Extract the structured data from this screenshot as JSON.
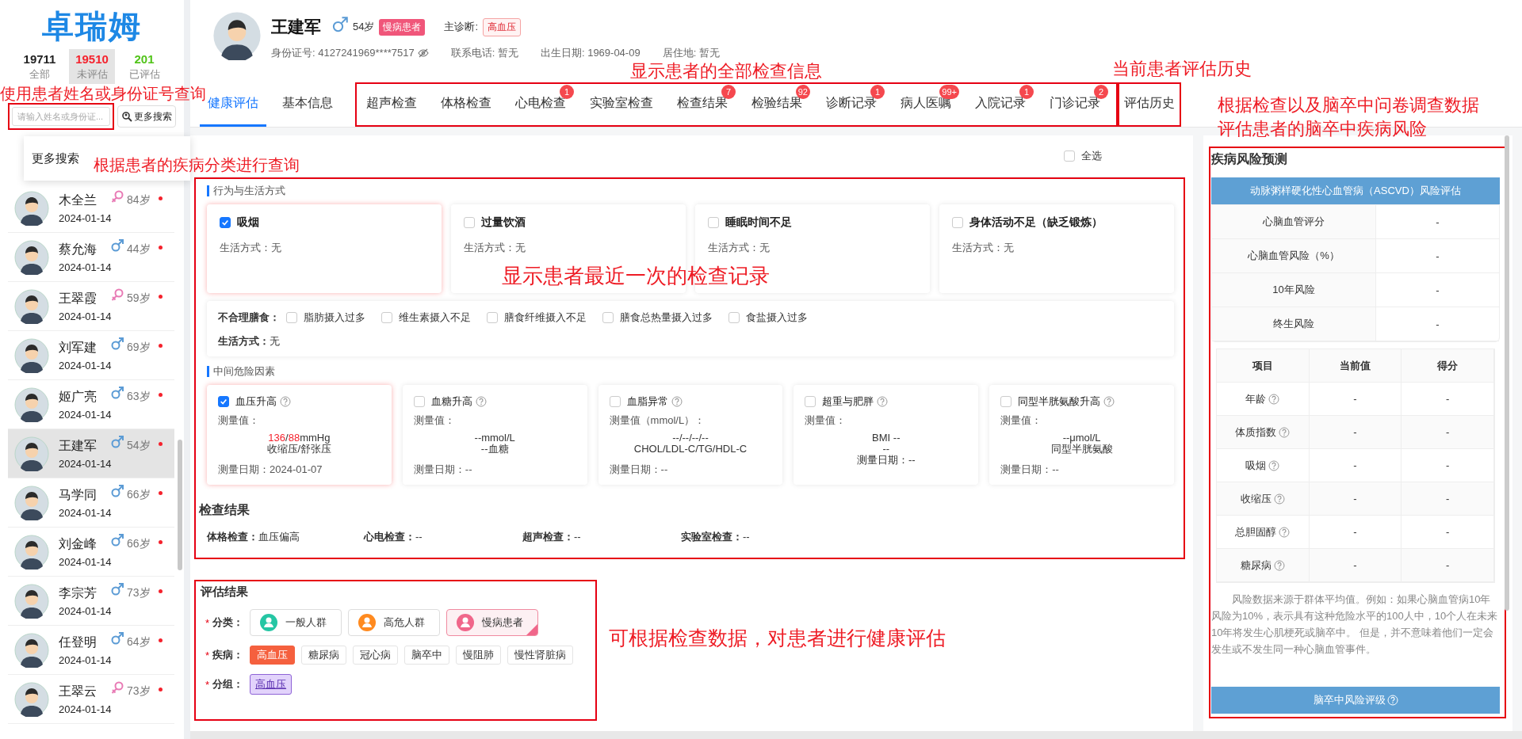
{
  "sidebar": {
    "logo": "卓瑞姆",
    "stats": [
      {
        "count": "19711",
        "label": "全部",
        "color": "#222222",
        "selected": false
      },
      {
        "count": "19510",
        "label": "未评估",
        "color": "#f5222d",
        "selected": true
      },
      {
        "count": "201",
        "label": "已评估",
        "color": "#52c41a",
        "selected": false
      }
    ],
    "search": {
      "placeholder": "请输入姓名或身份证..."
    },
    "more_button": "更多搜索",
    "popup": {
      "item": "更多搜索"
    },
    "patients": [
      {
        "name": "木全兰",
        "kind": "female",
        "color": "#e87bb5",
        "age": "84岁",
        "date": "2024-01-14",
        "flagged": true,
        "selected": false
      },
      {
        "name": "蔡允海",
        "kind": "male",
        "color": "#5b9bd5",
        "age": "44岁",
        "date": "2024-01-14",
        "flagged": true,
        "selected": false
      },
      {
        "name": "王翠霞",
        "kind": "female",
        "color": "#e87bb5",
        "age": "59岁",
        "date": "2024-01-14",
        "flagged": true,
        "selected": false
      },
      {
        "name": "刘军建",
        "kind": "male",
        "color": "#5b9bd5",
        "age": "69岁",
        "date": "2024-01-14",
        "flagged": true,
        "selected": false
      },
      {
        "name": "姬广亮",
        "kind": "male",
        "color": "#5b9bd5",
        "age": "63岁",
        "date": "2024-01-14",
        "flagged": true,
        "selected": false
      },
      {
        "name": "王建军",
        "kind": "male",
        "color": "#5b9bd5",
        "age": "54岁",
        "date": "2024-01-14",
        "flagged": true,
        "selected": true
      },
      {
        "name": "马学同",
        "kind": "male",
        "color": "#5b9bd5",
        "age": "66岁",
        "date": "2024-01-14",
        "flagged": true,
        "selected": false
      },
      {
        "name": "刘金峰",
        "kind": "male",
        "color": "#5b9bd5",
        "age": "66岁",
        "date": "2024-01-14",
        "flagged": true,
        "selected": false
      },
      {
        "name": "李宗芳",
        "kind": "male",
        "color": "#5b9bd5",
        "age": "73岁",
        "date": "2024-01-14",
        "flagged": true,
        "selected": false
      },
      {
        "name": "任登明",
        "kind": "male",
        "color": "#5b9bd5",
        "age": "64岁",
        "date": "2024-01-14",
        "flagged": true,
        "selected": false
      },
      {
        "name": "王翠云",
        "kind": "female",
        "color": "#e87bb5",
        "age": "73岁",
        "date": "2024-01-14",
        "flagged": true,
        "selected": false
      }
    ]
  },
  "patient": {
    "name": "王建军",
    "kind": "male",
    "color": "#5b9bd5",
    "age": "54岁",
    "badge": "慢病患者",
    "diagnosis_label": "主诊断:",
    "diagnosis": "高血压",
    "info": [
      {
        "text": "身份证号:  4127241969****7517",
        "masked": true
      },
      {
        "text": "联系电话: 暂无"
      },
      {
        "text": "出生日期: 1969-04-09"
      },
      {
        "text": "居住地:  暂无"
      }
    ]
  },
  "tabs": {
    "general": [
      {
        "label": "健康评估",
        "selected": true
      },
      {
        "label": "基本信息",
        "selected": false
      }
    ],
    "exam_records": [
      {
        "label": "超声检查",
        "selected": false
      },
      {
        "label": "体格检查",
        "selected": false
      },
      {
        "label": "心电检查",
        "badge": "1",
        "selected": false
      },
      {
        "label": "实验室检查",
        "selected": false
      },
      {
        "label": "检查结果",
        "badge": "7",
        "selected": false
      },
      {
        "label": "检验结果",
        "badge": "92",
        "selected": false
      },
      {
        "label": "诊断记录",
        "badge": "1",
        "selected": false
      },
      {
        "label": "病人医嘱",
        "badge": "99+",
        "selected": false
      },
      {
        "label": "入院记录",
        "badge": "1",
        "selected": false
      },
      {
        "label": "门诊记录",
        "badge": "2",
        "selected": false
      }
    ],
    "history": [
      {
        "label": "评估历史",
        "selected": false
      }
    ]
  },
  "content": {
    "select_all": {
      "label": "全选",
      "checked": false
    },
    "lifestyle": {
      "title": "行为与生活方式",
      "cards": [
        {
          "title": "吸烟",
          "checked": true,
          "detail": "生活方式：无"
        },
        {
          "title": "过量饮酒",
          "checked": false,
          "detail": "生活方式：无"
        },
        {
          "title": "睡眠时间不足",
          "checked": false,
          "detail": "生活方式：无"
        },
        {
          "title": "身体活动不足（缺乏锻炼）",
          "checked": false,
          "detail": "生活方式：无"
        }
      ],
      "diet": {
        "label": "不合理膳食：",
        "options": [
          {
            "label": "脂肪摄入过多",
            "checked": false
          },
          {
            "label": "维生素摄入不足",
            "checked": false
          },
          {
            "label": "膳食纤维摄入不足",
            "checked": false
          },
          {
            "label": "膳食总热量摄入过多",
            "checked": false
          },
          {
            "label": "食盐摄入过多",
            "checked": false
          }
        ],
        "detail": "**生活方式：**无"
      }
    },
    "risk_factors": {
      "title": "中间危险因素",
      "cards": [
        {
          "title": "血压升高",
          "checked": true,
          "measure": "测量值：",
          "lines": [
            [
              {
                "text": "136",
                "abnormal": true
              },
              {
                "text": "/",
                "abnormal": false
              },
              {
                "text": "88",
                "abnormal": true
              },
              {
                "text": "mmHg",
                "abnormal": false
              }
            ],
            [
              {
                "text": "收缩压/舒张压",
                "abnormal": false
              }
            ]
          ],
          "date": "测量日期：2024-01-07"
        },
        {
          "title": "血糖升高",
          "checked": false,
          "measure": "测量值：",
          "lines": [
            [
              {
                "text": "--mmol/L",
                "abnormal": false
              }
            ],
            [
              {
                "text": "--血糖",
                "abnormal": false
              }
            ]
          ],
          "date": "测量日期：--"
        },
        {
          "title": "血脂异常",
          "checked": false,
          "measure": "测量值（mmol/L）：",
          "lines": [
            [
              {
                "text": "--/--/--/--",
                "abnormal": false
              }
            ],
            [
              {
                "text": "CHOL/LDL-C/TG/HDL-C",
                "abnormal": false
              }
            ]
          ],
          "date": "测量日期：--"
        },
        {
          "title": "超重与肥胖",
          "checked": false,
          "measure": "测量值：",
          "lines": [
            [
              {
                "text": "BMI --",
                "abnormal": false
              }
            ],
            [
              {
                "text": "--",
                "abnormal": false
              }
            ],
            [
              {
                "text": "测量日期：--",
                "abnormal": false
              }
            ]
          ]
        },
        {
          "title": "同型半胱氨酸升高",
          "checked": false,
          "measure": "测量值：",
          "lines": [
            [
              {
                "text": "--μmol/L",
                "abnormal": false
              }
            ],
            [
              {
                "text": "同型半胱氨酸",
                "abnormal": false
              }
            ]
          ],
          "date": "测量日期：--"
        }
      ]
    },
    "exam_results": {
      "title": "检查结果",
      "items": [
        "**体格检查：**血压偏高",
        "**心电检查：**--",
        "**超声检查：**--",
        "**实验室检查：**--"
      ]
    },
    "evaluation": {
      "title": "评估结果",
      "required": "*",
      "category": {
        "label": "分类：",
        "options": [
          {
            "label": "一般人群",
            "color": "#25c6a4",
            "selected": false
          },
          {
            "label": "高危人群",
            "color": "#ff8a1f",
            "selected": false
          },
          {
            "label": "慢病患者",
            "color": "#f0668a",
            "selected": true
          }
        ]
      },
      "disease": {
        "label": "疾病：",
        "options": [
          {
            "label": "高血压",
            "selected": true
          },
          {
            "label": "糖尿病",
            "selected": false
          },
          {
            "label": "冠心病",
            "selected": false
          },
          {
            "label": "脑卒中",
            "selected": false
          },
          {
            "label": "慢阻肺",
            "selected": false
          },
          {
            "label": "慢性肾脏病",
            "selected": false
          }
        ]
      },
      "group": {
        "label": "分组：",
        "tags": [
          "高血压"
        ]
      }
    }
  },
  "risk_panel": {
    "title": "疾病风险预测",
    "ascvd": {
      "title": "动脉粥样硬化性心血管病（ASCVD）风险评估",
      "rows": [
        {
          "label": "心脑血管评分",
          "value": "-"
        },
        {
          "label": "心脑血管风险（%）",
          "value": "-"
        },
        {
          "label": "10年风险",
          "value": "-"
        },
        {
          "label": "终生风险",
          "value": "-"
        }
      ]
    },
    "factors": {
      "columns": [
        "项目",
        "当前值",
        "得分"
      ],
      "rows": [
        {
          "label": "年龄",
          "value": "-",
          "score": "-"
        },
        {
          "label": "体质指数",
          "value": "-",
          "score": "-"
        },
        {
          "label": "吸烟",
          "value": "-",
          "score": "-"
        },
        {
          "label": "收缩压",
          "value": "-",
          "score": "-"
        },
        {
          "label": "总胆固醇",
          "value": "-",
          "score": "-"
        },
        {
          "label": "糖尿病",
          "value": "-",
          "score": "-"
        }
      ]
    },
    "note": "风险数据来源于群体平均值。例如：如果心脑血管病10年风险为10%，表示具有这种危险水平的100人中，10个人在未来10年将发生心肌梗死或脑卒中。 但是，并不意味着他们一定会发生或不发生同一种心脑血管事件。",
    "stroke_button": "脑卒中风险评级"
  },
  "annotations": [
    {
      "text": "使用患者姓名或身份证号查询"
    },
    {
      "text": "根据患者的疾病分类进行查询"
    },
    {
      "text": "显示患者的全部检查信息"
    },
    {
      "text": "当前患者评估历史"
    },
    {
      "text": "根据检查以及脑卒中问卷调查数据"
    },
    {
      "text": "评估患者的脑卒中疾病风险"
    },
    {
      "text": "显示患者最近一次的检查记录"
    },
    {
      "text": "可根据检查数据，对患者进行健康评估"
    }
  ]
}
